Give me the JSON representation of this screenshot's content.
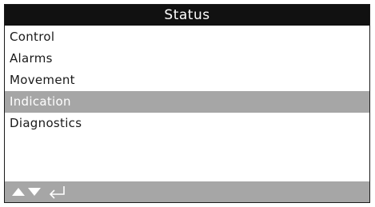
{
  "header": {
    "title": "Status"
  },
  "menu": {
    "items": [
      {
        "label": "Control",
        "selected": false
      },
      {
        "label": "Alarms",
        "selected": false
      },
      {
        "label": "Movement",
        "selected": false
      },
      {
        "label": "Indication",
        "selected": true
      },
      {
        "label": "Diagnostics",
        "selected": false
      }
    ]
  },
  "footer": {
    "buttons": [
      {
        "icon": "up-arrow-icon"
      },
      {
        "icon": "down-arrow-icon"
      },
      {
        "icon": "enter-icon"
      }
    ]
  },
  "colors": {
    "header_bg": "#111111",
    "header_text": "#ffffff",
    "selection_bg": "#a6a6a6",
    "footer_bg": "#a6a6a6",
    "text": "#1a1a1a"
  }
}
